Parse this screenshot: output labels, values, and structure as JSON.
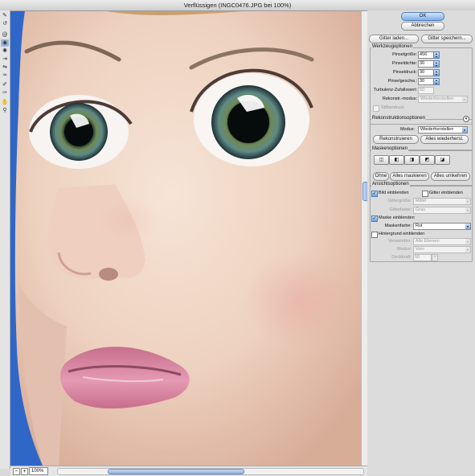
{
  "window": {
    "title": "Verflüssigen (INGC0476.JPG bei 100%)"
  },
  "tools": [
    {
      "icon": "forward-warp-icon",
      "glyph": "✎"
    },
    {
      "icon": "reconstruct-icon",
      "glyph": "↺"
    },
    {
      "icon": "twirl-icon",
      "glyph": "@"
    },
    {
      "icon": "pucker-icon",
      "glyph": "◉"
    },
    {
      "icon": "bloat-icon",
      "glyph": "✺"
    },
    {
      "icon": "push-left-icon",
      "glyph": "⇥"
    },
    {
      "icon": "mirror-icon",
      "glyph": "⇋"
    },
    {
      "icon": "turbulence-icon",
      "glyph": "≈"
    },
    {
      "icon": "freeze-mask-icon",
      "glyph": "✐"
    },
    {
      "icon": "thaw-mask-icon",
      "glyph": "✑"
    },
    {
      "icon": "hand-icon",
      "glyph": "✋"
    },
    {
      "icon": "zoom-icon",
      "glyph": "⚲"
    }
  ],
  "buttons": {
    "ok": "OK",
    "cancel": "Abbrechen",
    "load_mesh": "Gitter laden...",
    "save_mesh": "Gitter speichern..."
  },
  "tool_options": {
    "title": "Werkzeugoptionen",
    "brush_size_label": "Pinselgröße:",
    "brush_size": "456",
    "brush_density_label": "Pinseldichte:",
    "brush_density": "30",
    "brush_pressure_label": "Pinseldruck:",
    "brush_pressure": "30",
    "brush_rate_label": "Pinselgeschw.:",
    "brush_rate": "30",
    "turbulence_label": "Turbulenz-Zufallswert:",
    "turbulence": "50",
    "reconstruct_mode_label": "Rekonstr.-modus:",
    "reconstruct_mode": "Wiederherstellen",
    "stylus_label": "Stiftandruck"
  },
  "reconstruct_options": {
    "title": "Rekonstruktionsoptionen",
    "mode_label": "Modus:",
    "mode": "Wiederherstellen",
    "reconstruct_button": "Rekonstruieren",
    "restore_all_button": "Alles wiederherst."
  },
  "mask_options": {
    "title": "Maskenoptionen",
    "none_button": "Ohne",
    "mask_all_button": "Alles maskieren",
    "invert_all_button": "Alles umkehren"
  },
  "view_options": {
    "title": "Ansichtsoptionen",
    "show_image": "Bild einblenden",
    "show_mesh": "Gitter einblenden",
    "mesh_size_label": "Gittergröße:",
    "mesh_size": "Mittel",
    "mesh_color_label": "Gitterfarbe:",
    "mesh_color": "Grau",
    "show_mask": "Maske einblenden",
    "mask_color_label": "Maskenfarbe:",
    "mask_color": "Rot",
    "show_backdrop": "Hintergrund einblenden",
    "use_label": "Verwenden:",
    "use": "Alle Ebenen",
    "backdrop_mode_label": "Modus:",
    "backdrop_mode": "Vorn",
    "opacity_label": "Deckkraft:",
    "opacity": "50"
  },
  "status": {
    "zoom": "100%",
    "zoom_out": "−",
    "zoom_in": "+"
  },
  "colors": {
    "accent": "#7eaee8",
    "panel": "#dcdcdc",
    "canvas_backdrop": "#2f67c9"
  }
}
